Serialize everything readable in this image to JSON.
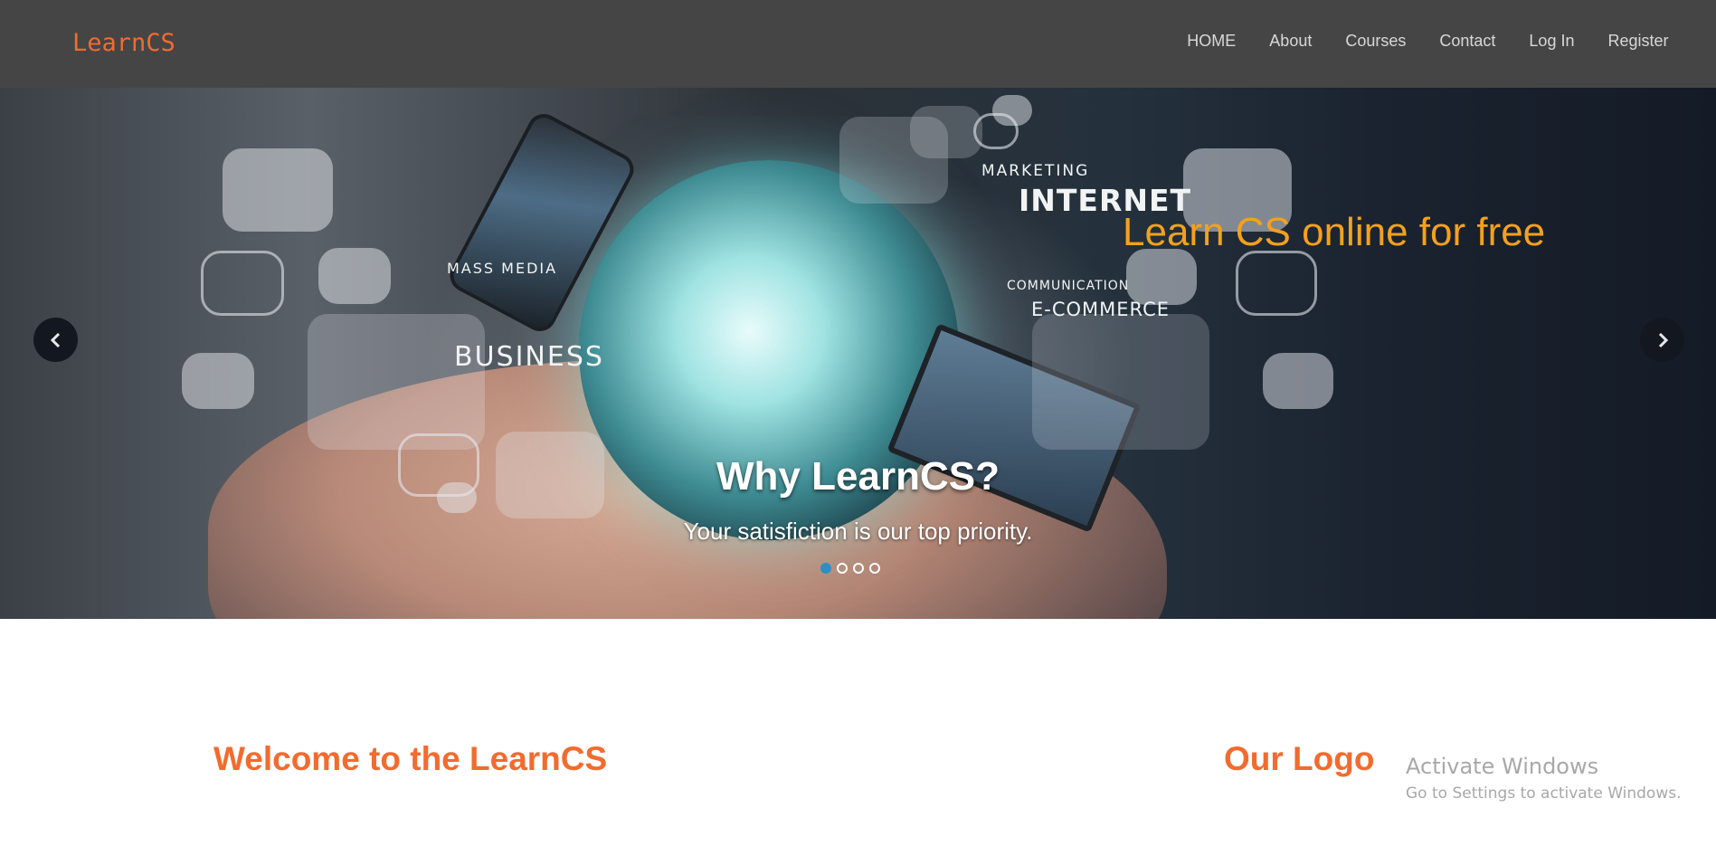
{
  "header": {
    "brand": "LearnCS",
    "nav": [
      "HOME",
      "About",
      "Courses",
      "Contact",
      "Log In",
      "Register"
    ]
  },
  "hero": {
    "image_tags": {
      "marketing": "MARKETING",
      "internet": "INTERNET",
      "mass_media": "MASS MEDIA",
      "communication": "COMMUNICATION",
      "ecommerce": "E-COMMERCE",
      "business": "BUSINESS"
    },
    "side_text": "Learn CS online for free",
    "caption_title": "Why LearnCS?",
    "caption_text": "Your satisfiction is our top priority.",
    "slide_count": 4,
    "active_slide": 1,
    "prev_icon": "chevron-left-icon",
    "next_icon": "chevron-right-icon"
  },
  "content": {
    "welcome_heading": "Welcome to the LearnCS",
    "logo_heading": "Our Logo"
  },
  "windows_watermark": {
    "title": "Activate Windows",
    "subtitle": "Go to Settings to activate Windows."
  },
  "colors": {
    "brand": "#f26b2f",
    "navbar": "#454545",
    "side_text": "#f3a11d",
    "active_dot": "#2a8fc4"
  }
}
